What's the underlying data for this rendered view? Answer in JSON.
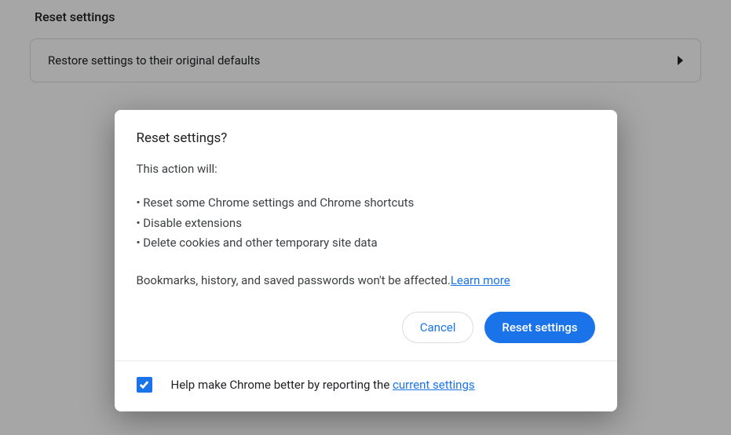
{
  "page": {
    "section_heading": "Reset settings",
    "restore_row_label": "Restore settings to their original defaults"
  },
  "dialog": {
    "title": "Reset settings?",
    "intro": "This action will:",
    "bullets": [
      "Reset some Chrome settings and Chrome shortcuts",
      "Disable extensions",
      "Delete cookies and other temporary site data"
    ],
    "footnote_prefix": "Bookmarks, history, and saved passwords won't be affected.",
    "learn_more": "Learn more",
    "cancel_label": "Cancel",
    "confirm_label": "Reset settings",
    "footer_prefix": "Help make Chrome better by reporting the ",
    "footer_link": "current settings",
    "checkbox_checked": true
  }
}
